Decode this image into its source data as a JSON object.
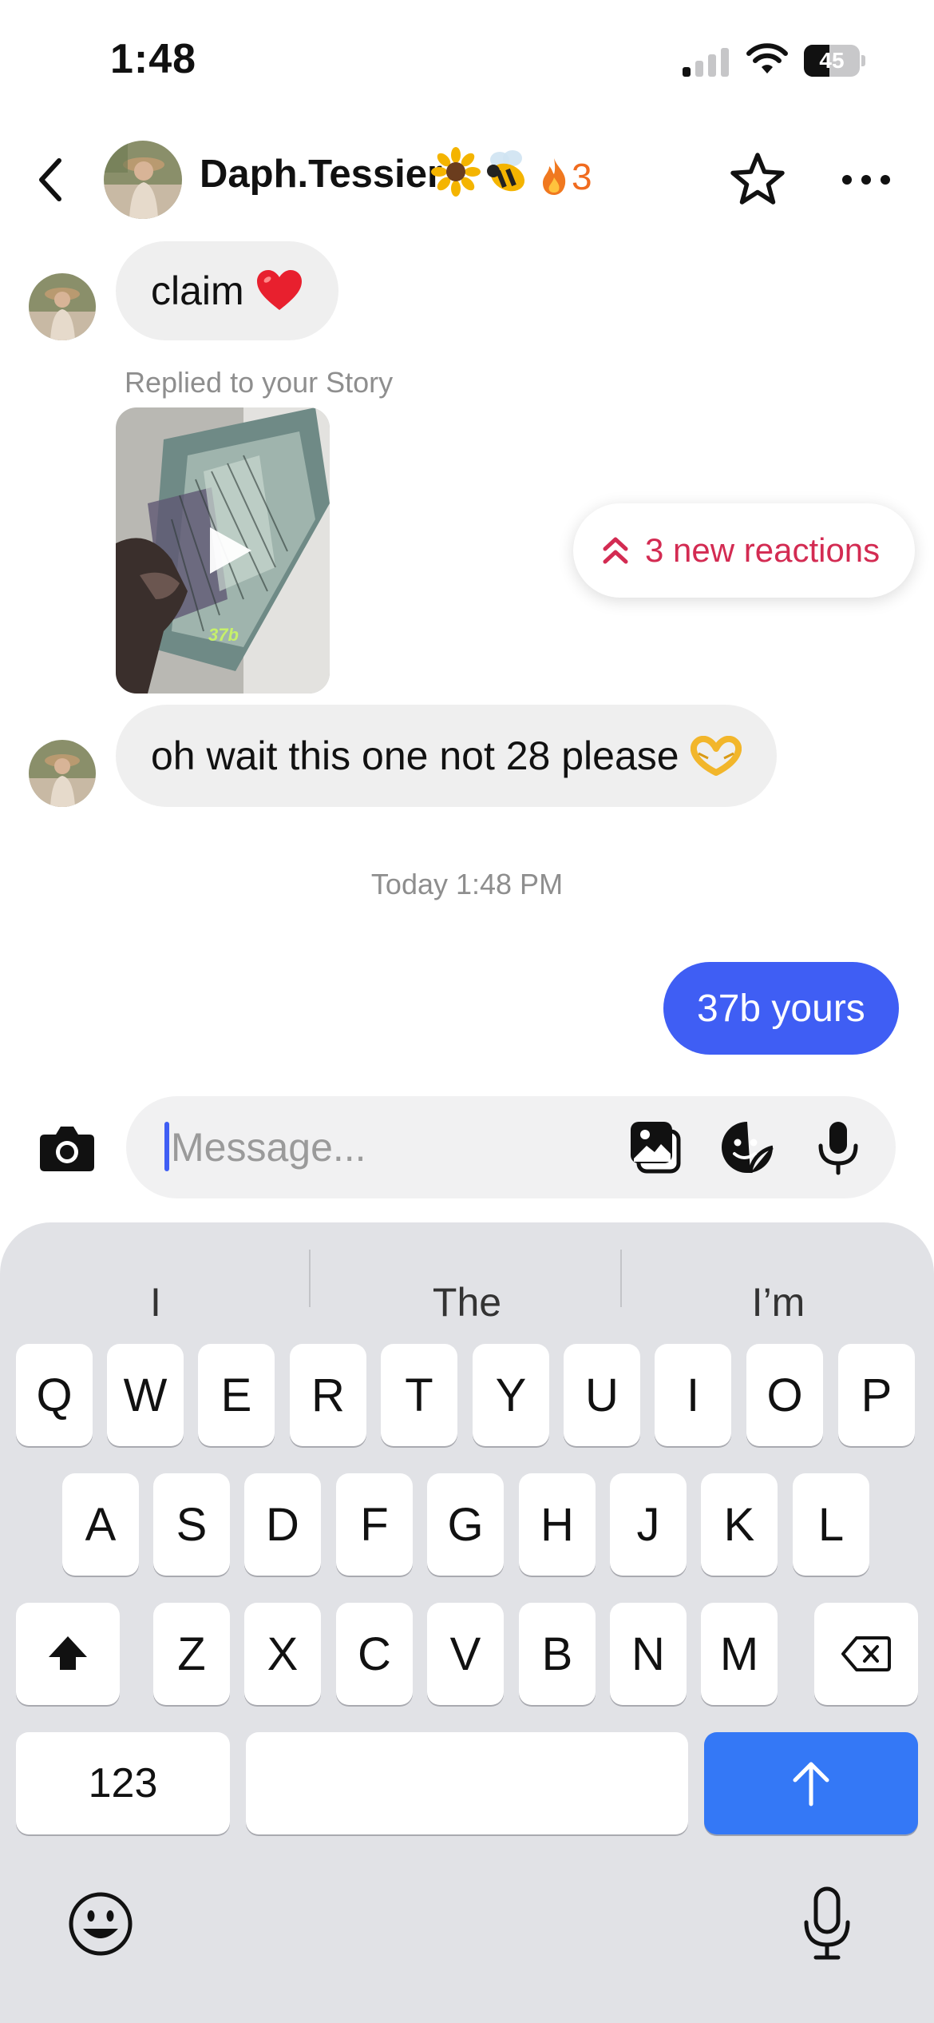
{
  "status_bar": {
    "time": "1:48",
    "battery_percent": "45",
    "battery_level": 0.45,
    "signal_bars_active": 1,
    "signal_bars_total": 4
  },
  "header": {
    "contact_name": "Daph.Tessier",
    "name_emojis": [
      "sunflower-icon",
      "bee-icon"
    ],
    "streak_icon": "fire-icon",
    "streak_count": "3",
    "icons": [
      "chevron-left-icon",
      "star-icon",
      "more-icon"
    ]
  },
  "messages": {
    "msg1": {
      "text": "claim",
      "emoji": "heart-icon"
    },
    "story_reply": {
      "label": "Replied to your Story",
      "media_caption": "37b",
      "media_type": "video"
    },
    "msg2": {
      "text": "oh wait this one not 28 please",
      "emoji": "heart-hands-icon"
    },
    "timestamp": "Today 1:48 PM",
    "msg3": {
      "text": "37b yours"
    }
  },
  "reactions_banner": {
    "label": "3 new reactions",
    "icon": "double-chevron-up-icon"
  },
  "composer": {
    "placeholder": "Message...",
    "value": "",
    "icons": [
      "camera-icon",
      "gallery-icon",
      "sticker-icon",
      "microphone-icon"
    ]
  },
  "keyboard": {
    "suggestions": [
      "I",
      "The",
      "I’m"
    ],
    "row1": [
      "Q",
      "W",
      "E",
      "R",
      "T",
      "Y",
      "U",
      "I",
      "O",
      "P"
    ],
    "row2": [
      "A",
      "S",
      "D",
      "F",
      "G",
      "H",
      "J",
      "K",
      "L"
    ],
    "row3": [
      "Z",
      "X",
      "C",
      "V",
      "B",
      "N",
      "M"
    ],
    "numbers_label": "123",
    "colors": {
      "return_key": "#3478f6",
      "accent": "#3f5ef4"
    }
  }
}
